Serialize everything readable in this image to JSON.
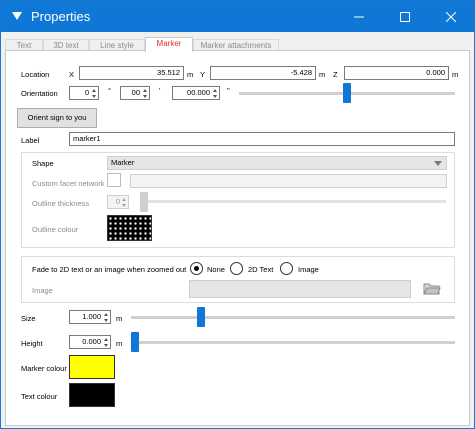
{
  "window": {
    "title": "Properties"
  },
  "tabs": [
    "Text",
    "3D text",
    "Line style",
    "Marker",
    "Marker attachments"
  ],
  "location": {
    "label": "Location",
    "x_label": "X",
    "x_value": "35.512",
    "x_unit": "m",
    "y_label": "Y",
    "y_value": "-5.428",
    "y_unit": "m",
    "z_label": "Z",
    "z_value": "0.000",
    "z_unit": "m"
  },
  "orientation": {
    "label": "Orientation",
    "deg": "0",
    "deg_unit": "°",
    "min": "00",
    "min_unit": "'",
    "sec": "00.000",
    "sec_unit": "\"",
    "slider_fraction": 0.5
  },
  "orient_button": "Orient sign to you",
  "label_field": {
    "label": "Label",
    "value": "marker1"
  },
  "shape": {
    "label": "Shape",
    "value": "Marker"
  },
  "custom_facet": {
    "label": "Custom facet network"
  },
  "outline_thickness": {
    "label": "Outline thickness",
    "value": "0"
  },
  "outline_colour": {
    "label": "Outline colour"
  },
  "fade": {
    "label": "Fade to 2D text or an image when zoomed out",
    "options": [
      "None",
      "2D Text",
      "Image"
    ],
    "selected": "None"
  },
  "image": {
    "label": "Image"
  },
  "size": {
    "label": "Size",
    "value": "1.000",
    "unit": "m",
    "slider_fraction": 0.22
  },
  "height": {
    "label": "Height",
    "value": "0.000",
    "unit": "m",
    "slider_fraction": 0.0
  },
  "marker_colour": {
    "label": "Marker colour",
    "color": "#ffff00"
  },
  "text_colour": {
    "label": "Text colour",
    "color": "#000000"
  },
  "colors": {
    "accent": "#0f78d6",
    "active_tab": "#e0302c"
  }
}
